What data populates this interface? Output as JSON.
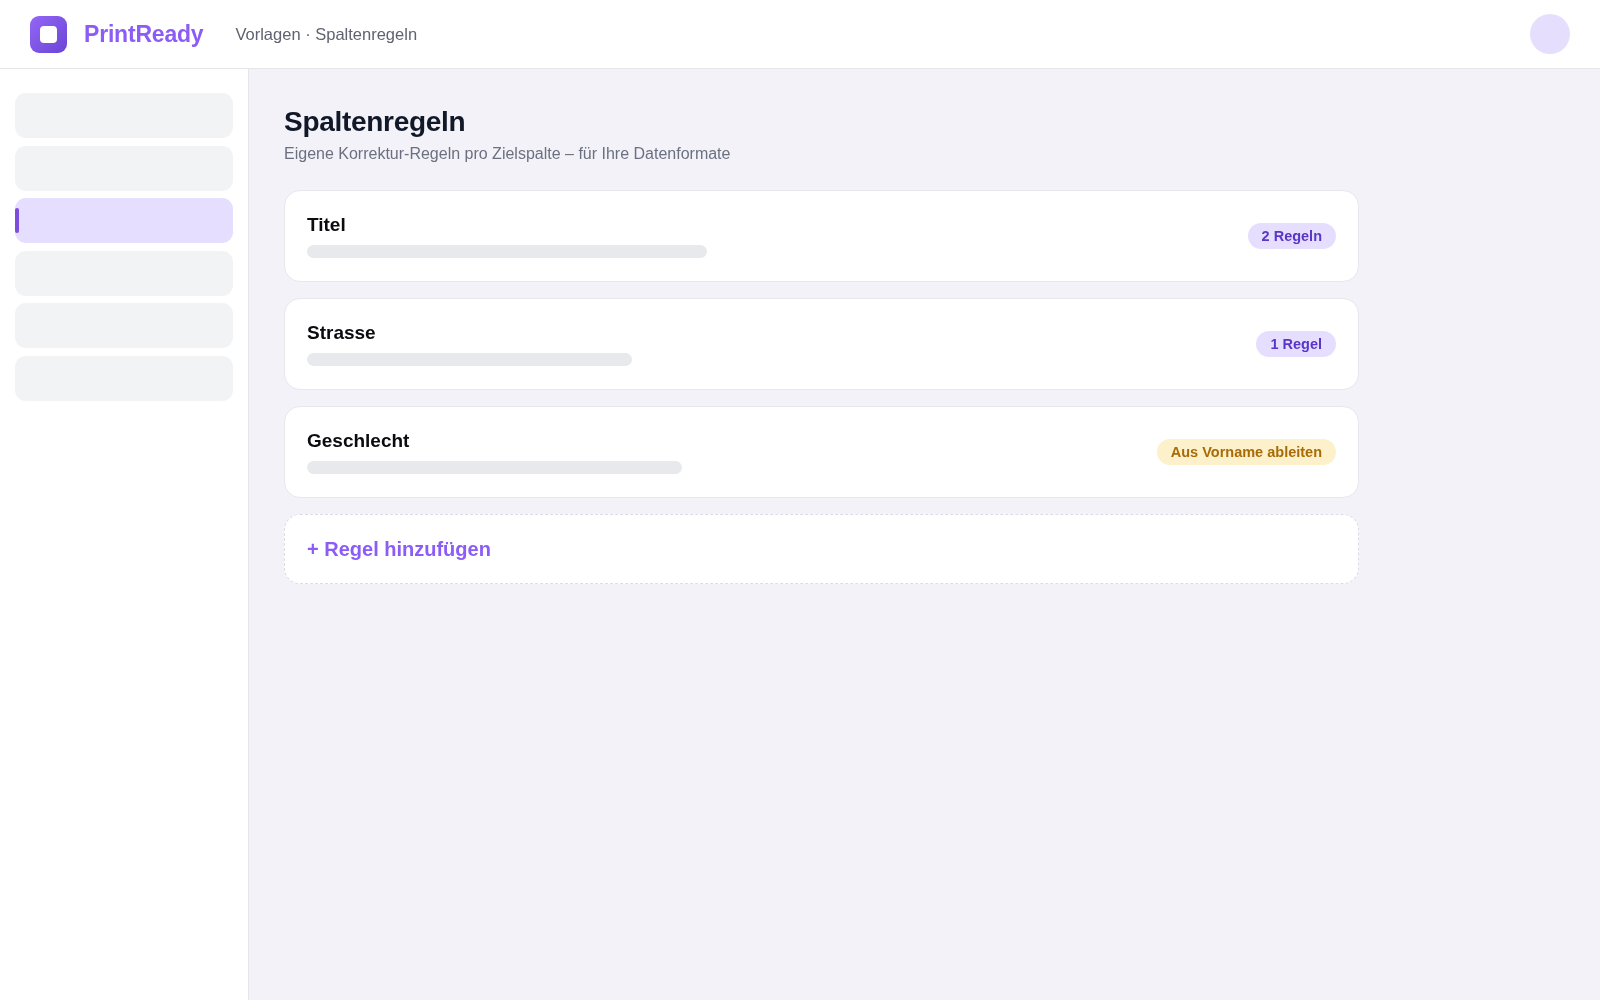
{
  "header": {
    "brand": "PrintReady",
    "breadcrumb": "Vorlagen · Spaltenregeln"
  },
  "sidebar": {
    "items": [
      {
        "selected": false
      },
      {
        "selected": false
      },
      {
        "selected": true
      },
      {
        "selected": false
      },
      {
        "selected": false
      },
      {
        "selected": false
      }
    ]
  },
  "page": {
    "title": "Spaltenregeln",
    "subtitle": "Eigene Korrektur-Regeln pro Zielspalte – für Ihre Datenformate"
  },
  "rules": [
    {
      "column": "Titel",
      "badge": {
        "text": "2 Regeln",
        "kind": "count"
      }
    },
    {
      "column": "Strasse",
      "badge": {
        "text": "1 Regel",
        "kind": "count"
      }
    },
    {
      "column": "Geschlecht",
      "badge": {
        "text": "Aus Vorname ableiten",
        "kind": "derived"
      }
    }
  ],
  "add_button": "+ Regel hinzufügen"
}
